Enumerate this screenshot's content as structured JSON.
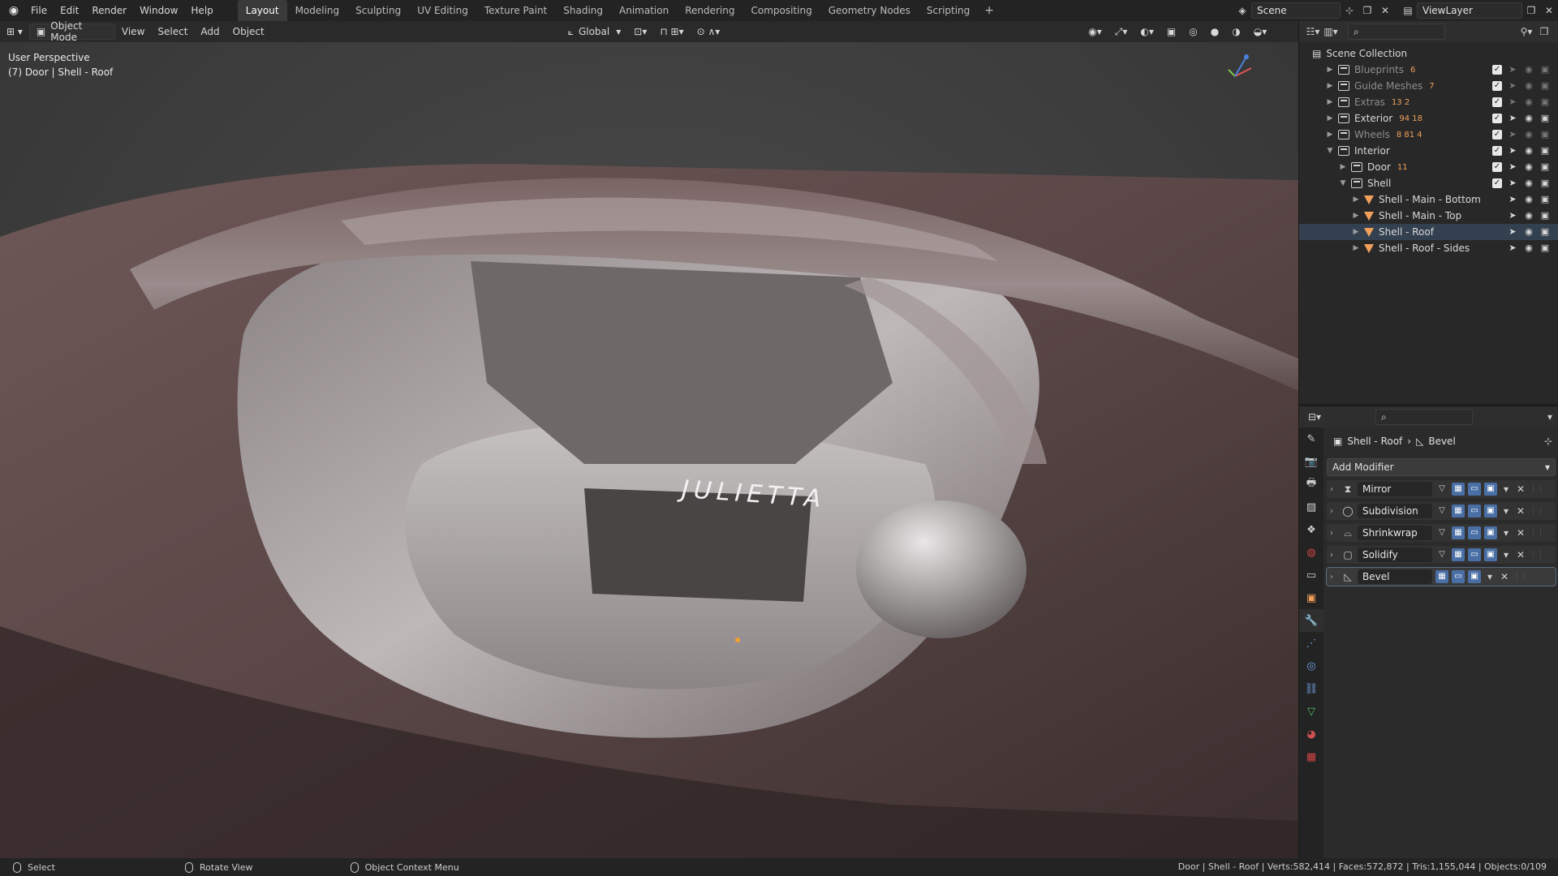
{
  "topbar": {
    "menus": [
      "File",
      "Edit",
      "Render",
      "Window",
      "Help"
    ],
    "workspaces": [
      "Layout",
      "Modeling",
      "Sculpting",
      "UV Editing",
      "Texture Paint",
      "Shading",
      "Animation",
      "Rendering",
      "Compositing",
      "Geometry Nodes",
      "Scripting"
    ],
    "active_workspace": "Layout",
    "scene": "Scene",
    "view_layer": "ViewLayer"
  },
  "viewport_header": {
    "mode": "Object Mode",
    "menus": [
      "View",
      "Select",
      "Add",
      "Object"
    ],
    "transform_orientation": "Global"
  },
  "viewport": {
    "perspective": "User Perspective",
    "context": "(7) Door | Shell - Roof",
    "badge_text": "JULIETTA"
  },
  "outliner": {
    "root": "Scene Collection",
    "rows": [
      {
        "label": "Blueprints",
        "type": "collection",
        "depth": 1,
        "dim": true,
        "count": "6",
        "expanded": false
      },
      {
        "label": "Guide Meshes",
        "type": "collection",
        "depth": 1,
        "dim": true,
        "count": "7",
        "expanded": false
      },
      {
        "label": "Extras",
        "type": "collection",
        "depth": 1,
        "dim": true,
        "count": "13  2",
        "expanded": false
      },
      {
        "label": "Exterior",
        "type": "collection",
        "depth": 1,
        "dim": false,
        "count": "94  18",
        "expanded": false
      },
      {
        "label": "Wheels",
        "type": "collection",
        "depth": 1,
        "dim": true,
        "count": "8  81  4",
        "expanded": false
      },
      {
        "label": "Interior",
        "type": "collection",
        "depth": 1,
        "dim": false,
        "count": "",
        "expanded": true
      },
      {
        "label": "Door",
        "type": "collection",
        "depth": 2,
        "dim": false,
        "count": "11",
        "expanded": false
      },
      {
        "label": "Shell",
        "type": "collection",
        "depth": 2,
        "dim": false,
        "count": "",
        "expanded": true
      },
      {
        "label": "Shell - Main - Bottom",
        "type": "mesh",
        "depth": 3,
        "dim": false,
        "count": "",
        "expanded": false
      },
      {
        "label": "Shell - Main - Top",
        "type": "mesh",
        "depth": 3,
        "dim": false,
        "count": "",
        "expanded": false
      },
      {
        "label": "Shell - Roof",
        "type": "mesh",
        "depth": 3,
        "dim": false,
        "count": "",
        "expanded": false
      },
      {
        "label": "Shell - Roof - Sides",
        "type": "mesh",
        "depth": 3,
        "dim": false,
        "count": "",
        "expanded": false
      }
    ]
  },
  "properties": {
    "breadcrumb_object": "Shell - Roof",
    "breadcrumb_modifier": "Bevel",
    "add_modifier": "Add Modifier",
    "modifiers": [
      {
        "name": "Mirror",
        "icon": "mirror-icon",
        "active": false
      },
      {
        "name": "Subdivision",
        "icon": "subdivision-icon",
        "active": false
      },
      {
        "name": "Shrinkwrap",
        "icon": "shrinkwrap-icon",
        "active": false
      },
      {
        "name": "Solidify",
        "icon": "solidify-icon",
        "active": false
      },
      {
        "name": "Bevel",
        "icon": "bevel-icon",
        "active": true
      }
    ]
  },
  "statusbar": {
    "select": "Select",
    "rotate": "Rotate View",
    "context_menu": "Object Context Menu",
    "stats": "Door | Shell - Roof | Verts:582,414 | Faces:572,872 | Tris:1,155,044 | Objects:0/109"
  },
  "colors": {
    "accent": "#4a6fa5",
    "mesh_orange": "#f0a05a",
    "background": "#1d1d1d"
  }
}
